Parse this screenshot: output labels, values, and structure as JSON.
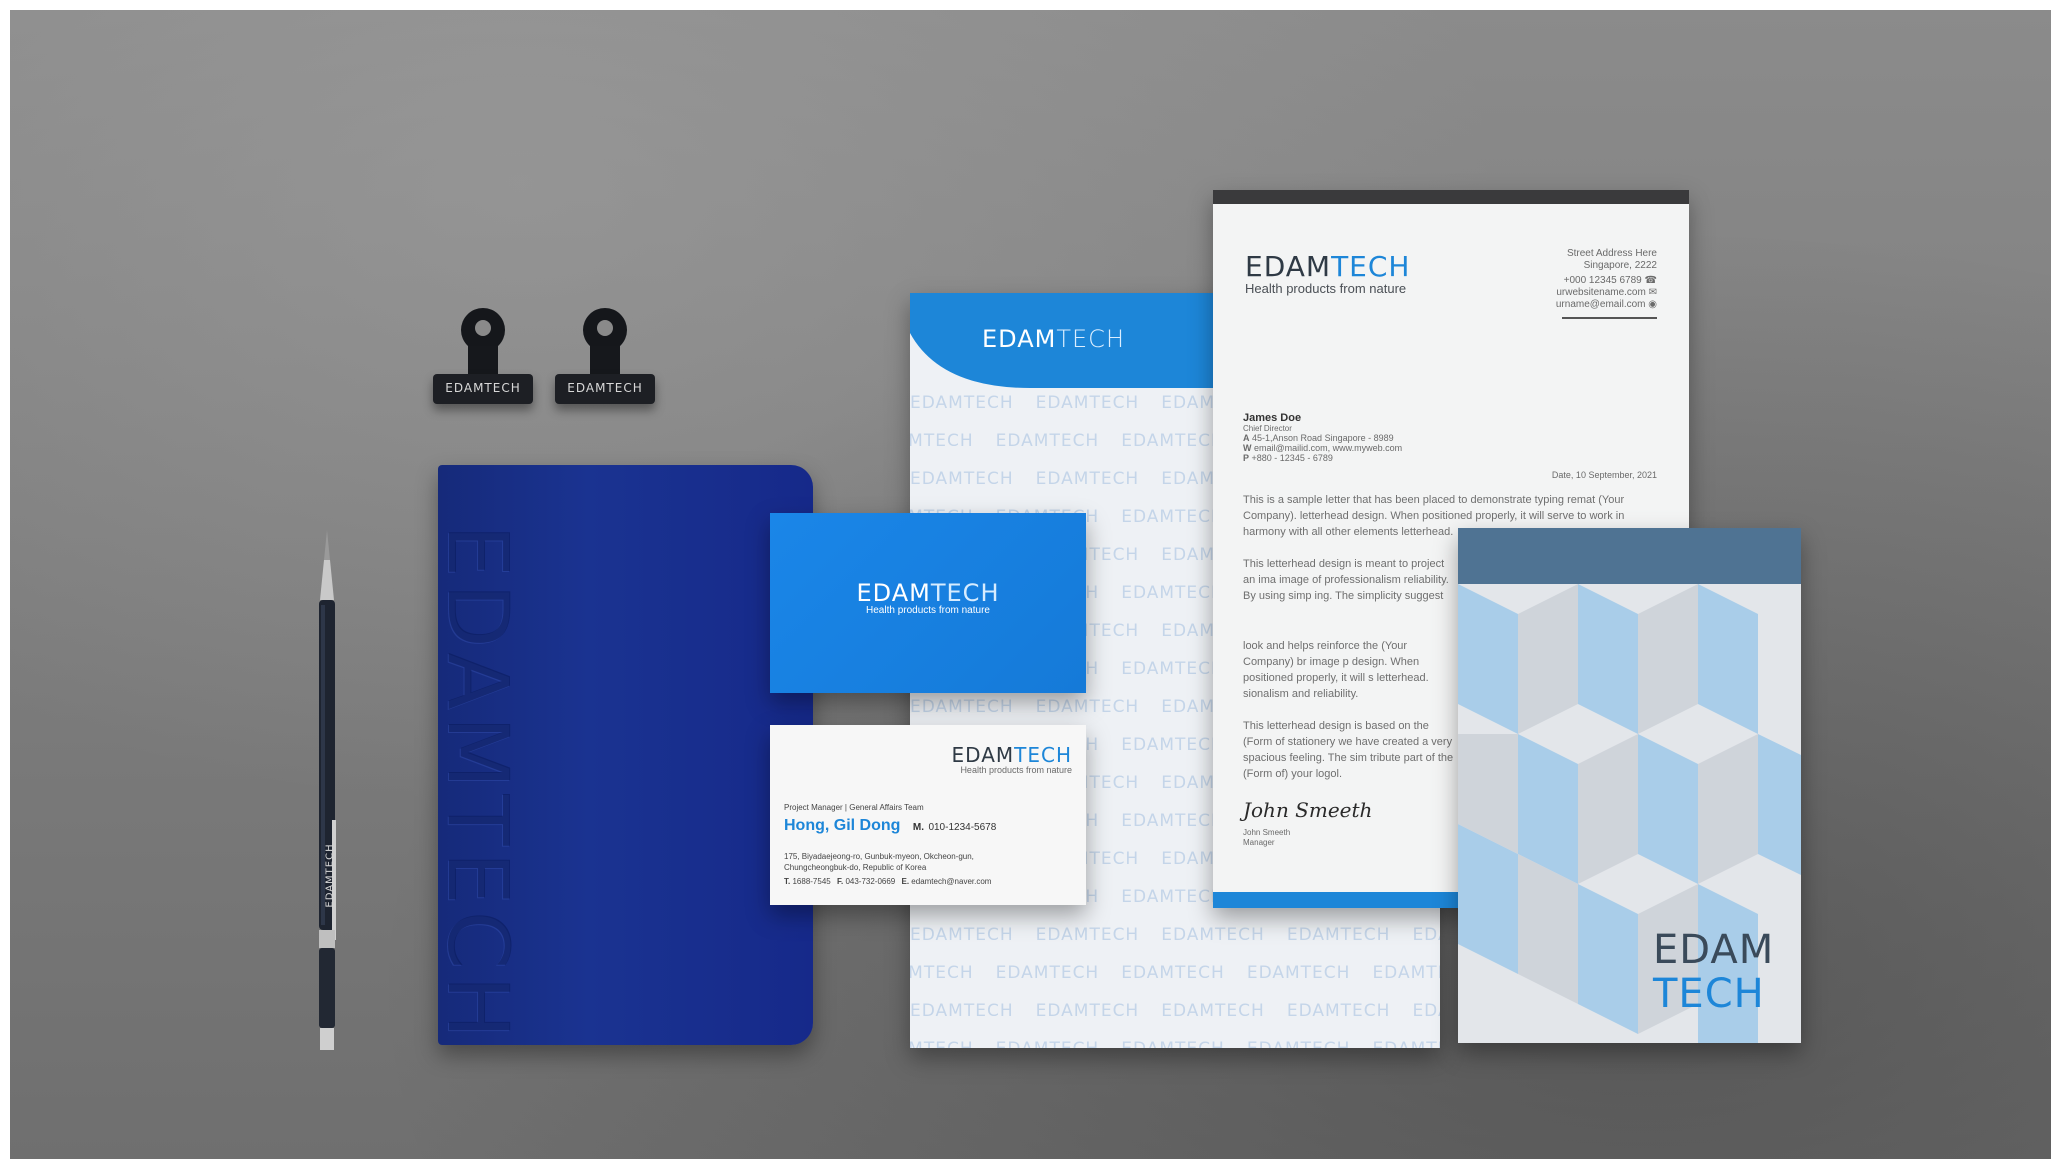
{
  "scene": {
    "colors": {
      "background": "#7e7e7e",
      "brand_blue": "#1d86d8",
      "notebook_blue": "#1a3391",
      "notepad_band": "#4f7393"
    }
  },
  "brand": {
    "edam": "EDAM",
    "tech": "TECH",
    "slogan": "Health products from nature"
  },
  "clips": [
    {
      "label": "EDAMTECH"
    },
    {
      "label": "EDAMTECH"
    }
  ],
  "pen": {
    "label": "EDAMTECH"
  },
  "notebook": {
    "emboss": "EDAMTECH"
  },
  "pattern_sheet": {
    "repeat_text": "EDAMTECH"
  },
  "letterhead": {
    "address": [
      "Street Address Here",
      "Singapore, 2222"
    ],
    "contacts": [
      "+000 12345 6789",
      "urwebsitename.com",
      "urname@email.com"
    ],
    "recipient": {
      "name": "James Doe",
      "title": "Chief Director",
      "address": "45-1,Anson Road Singapore - 8989",
      "web": "email@mailid.com, www.myweb.com",
      "phone": "+880 - 12345 - 6789"
    },
    "labels": {
      "a": "A",
      "w": "W",
      "p": "P"
    },
    "date": "Date, 10 September, 2021",
    "paragraphs": [
      "This is a sample letter that has been placed to demonstrate typing remat (Your Company). letterhead design. When positioned properly, it will serve to work in harmony with all other elements letterhead.",
      "This letterhead design is meant to project an ima image of professionalism reliability. By using simp ing. The simplicity suggest rengththe spaciousnes qualities along with the (Your Company)",
      "look and helps reinforce the (Your Company) br image p design. When positioned properly, it will s letterhead. sionalism and reliability.",
      "This letterhead design is based on the (Form of stationery we have created a very spacious feeling. The sim tribute part of the (Form of) your logol."
    ],
    "signature": "John Smeeth",
    "signer_name": "John Smeeth",
    "signer_title": "Manager"
  },
  "business_card": {
    "role": "Project Manager | General Affairs Team",
    "name": "Hong, Gil Dong",
    "mobile_label": "M.",
    "mobile": "010-1234-5678",
    "address_line1": "175, Biyadaejeong-ro, Gunbuk-myeon, Okcheon-gun,",
    "address_line2": "Chungcheongbuk-do, Republic of Korea",
    "tel_label": "T.",
    "tel": "1688-7545",
    "fax_label": "F.",
    "fax": "043-732-0669",
    "email_label": "E.",
    "email": "edamtech@naver.com"
  },
  "notepad": {
    "edam": "EDAM",
    "tech": "TECH"
  }
}
